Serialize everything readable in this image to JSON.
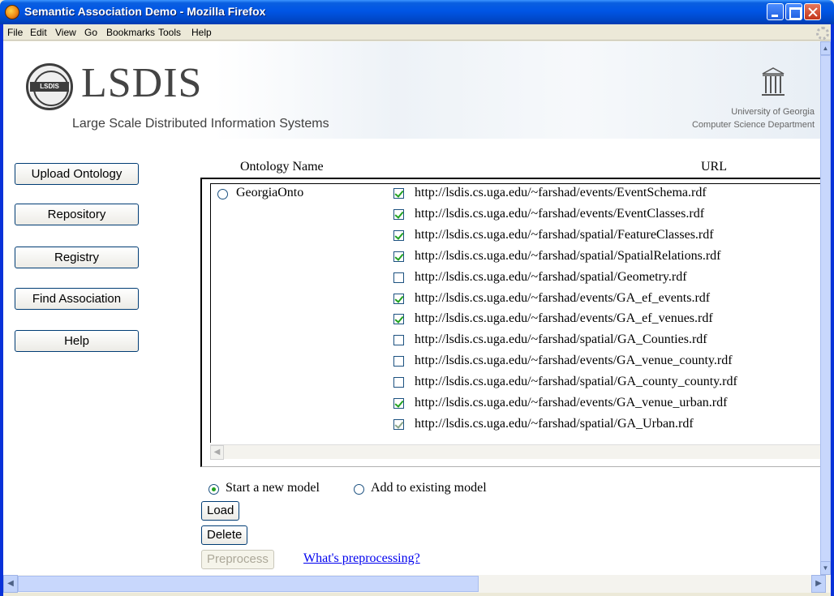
{
  "window": {
    "title": "Semantic Association Demo - Mozilla Firefox"
  },
  "menu": [
    "File",
    "Edit",
    "View",
    "Go",
    "Bookmarks",
    "Tools",
    "Help"
  ],
  "header": {
    "logo_badge": "LSDIS",
    "logo_title": "LSDIS",
    "logo_subtitle": "Large Scale Distributed Information Systems",
    "uga_line1": "University of Georgia",
    "uga_line2": "Computer Science Department"
  },
  "sidebar": [
    "Upload Ontology",
    "Repository",
    "Registry",
    "Find Association",
    "Help"
  ],
  "table": {
    "col_name": "Ontology Name",
    "col_url": "URL",
    "ontology": {
      "name": "GeorgiaOnto",
      "selected": false
    },
    "urls": [
      {
        "url": "http://lsdis.cs.uga.edu/~farshad/events/EventSchema.rdf",
        "checked": true
      },
      {
        "url": "http://lsdis.cs.uga.edu/~farshad/events/EventClasses.rdf",
        "checked": true
      },
      {
        "url": "http://lsdis.cs.uga.edu/~farshad/spatial/FeatureClasses.rdf",
        "checked": true
      },
      {
        "url": "http://lsdis.cs.uga.edu/~farshad/spatial/SpatialRelations.rdf",
        "checked": true
      },
      {
        "url": "http://lsdis.cs.uga.edu/~farshad/spatial/Geometry.rdf",
        "checked": false
      },
      {
        "url": "http://lsdis.cs.uga.edu/~farshad/events/GA_ef_events.rdf",
        "checked": true
      },
      {
        "url": "http://lsdis.cs.uga.edu/~farshad/events/GA_ef_venues.rdf",
        "checked": true
      },
      {
        "url": "http://lsdis.cs.uga.edu/~farshad/spatial/GA_Counties.rdf",
        "checked": false
      },
      {
        "url": "http://lsdis.cs.uga.edu/~farshad/events/GA_venue_county.rdf",
        "checked": false
      },
      {
        "url": "http://lsdis.cs.uga.edu/~farshad/spatial/GA_county_county.rdf",
        "checked": false
      },
      {
        "url": "http://lsdis.cs.uga.edu/~farshad/events/GA_venue_urban.rdf",
        "checked": true
      },
      {
        "url": "http://lsdis.cs.uga.edu/~farshad/spatial/GA_Urban.rdf",
        "checked": true
      }
    ]
  },
  "model": {
    "option_new": "Start a new model",
    "option_existing": "Add to existing model",
    "selected": "new"
  },
  "actions": {
    "load": "Load",
    "delete": "Delete",
    "preprocess": "Preprocess",
    "preprocess_help": "What's preprocessing?"
  }
}
